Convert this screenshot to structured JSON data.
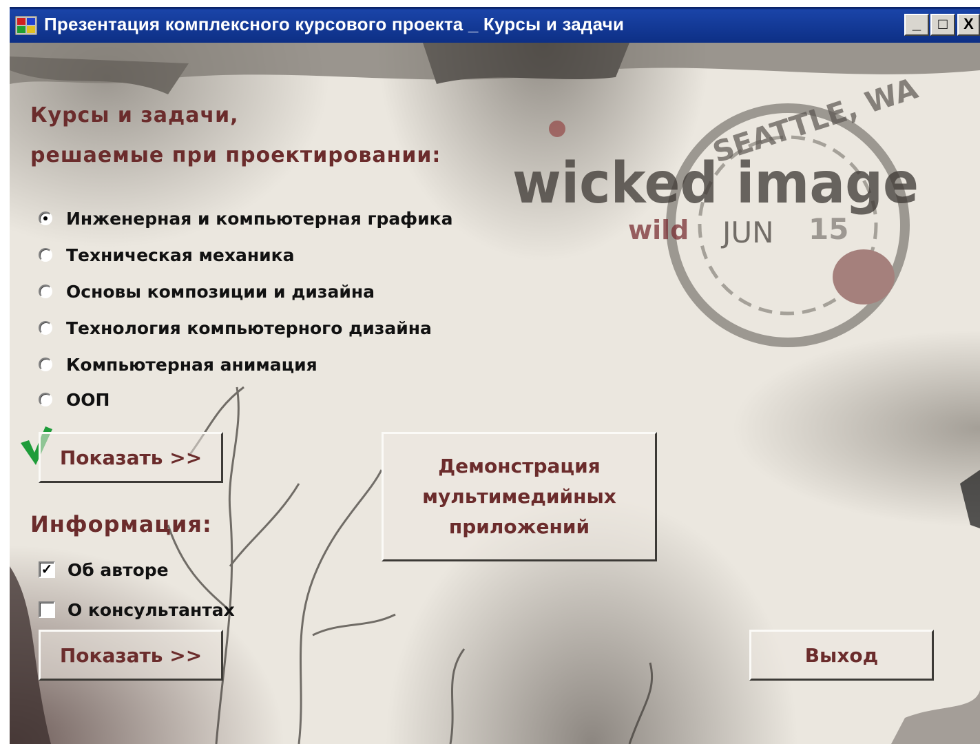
{
  "window": {
    "title": "Презентация комплексного курсового проекта _ Курсы и задачи",
    "controls": {
      "minimize": "_",
      "maximize": "□",
      "close": "X"
    }
  },
  "background": {
    "stamp_text": "wicked image",
    "stamp_sub": "wild",
    "stamp_city": "SEATTLE, WA",
    "stamp_date_month": "JUN",
    "stamp_date_day": "15"
  },
  "courses": {
    "heading_line1": "Курсы и задачи,",
    "heading_line2": "решаемые при проектировании:",
    "options": [
      {
        "label": "Инженерная и компьютерная графика",
        "selected": true
      },
      {
        "label": "Техническая механика",
        "selected": false
      },
      {
        "label": "Основы композиции и дизайна",
        "selected": false
      },
      {
        "label": "Технология компьютерного дизайна",
        "selected": false
      },
      {
        "label": "Компьютерная анимация",
        "selected": false
      },
      {
        "label": "ООП",
        "selected": false
      }
    ],
    "show_button": "Показать >>"
  },
  "demo_button": "Демонстрация мультимедийных приложений",
  "info": {
    "heading": "Информация:",
    "options": [
      {
        "label": "Об авторе",
        "checked": true
      },
      {
        "label": "О консультантах",
        "checked": false
      }
    ],
    "show_button": "Показать >>"
  },
  "exit_button": "Выход",
  "colors": {
    "heading": "#6b2c2c",
    "titlebar": "#0d2f85",
    "check_mark": "#1e9c3a"
  }
}
